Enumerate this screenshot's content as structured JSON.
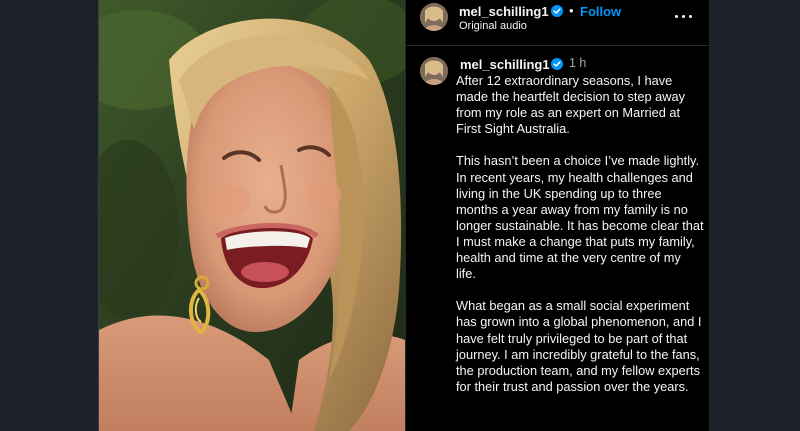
{
  "post": {
    "header": {
      "username": "mel_schilling1",
      "follow_label": "Follow",
      "separator": "•",
      "audio_label": "Original audio"
    },
    "caption": {
      "username": "mel_schilling1",
      "time": "1 h",
      "paragraphs": [
        "After 12 extraordinary seasons, I have made the heartfelt decision to step away from my role as an expert on Married at First Sight Australia.",
        "This hasn’t been a choice I’ve made lightly. In recent years, my health challenges and living in the UK spending up to three months a year away from my family is no longer sustainable. It has become clear that I must make a change that puts my family, health and time at the very centre of my life.",
        "What began as a small social experiment has grown into a global phenomenon, and I have felt truly privileged to be part of that journey. I am incredibly grateful to the fans, the production team, and my fellow experts for their trust and passion over the years."
      ]
    }
  },
  "icons": {
    "verified": "verified-badge-icon",
    "more": "more-options-icon"
  },
  "colors": {
    "follow": "#0095f6",
    "verified": "#0095f6",
    "panel_bg": "#000000",
    "text": "#f5f5f5",
    "muted": "#a8a8a8"
  }
}
